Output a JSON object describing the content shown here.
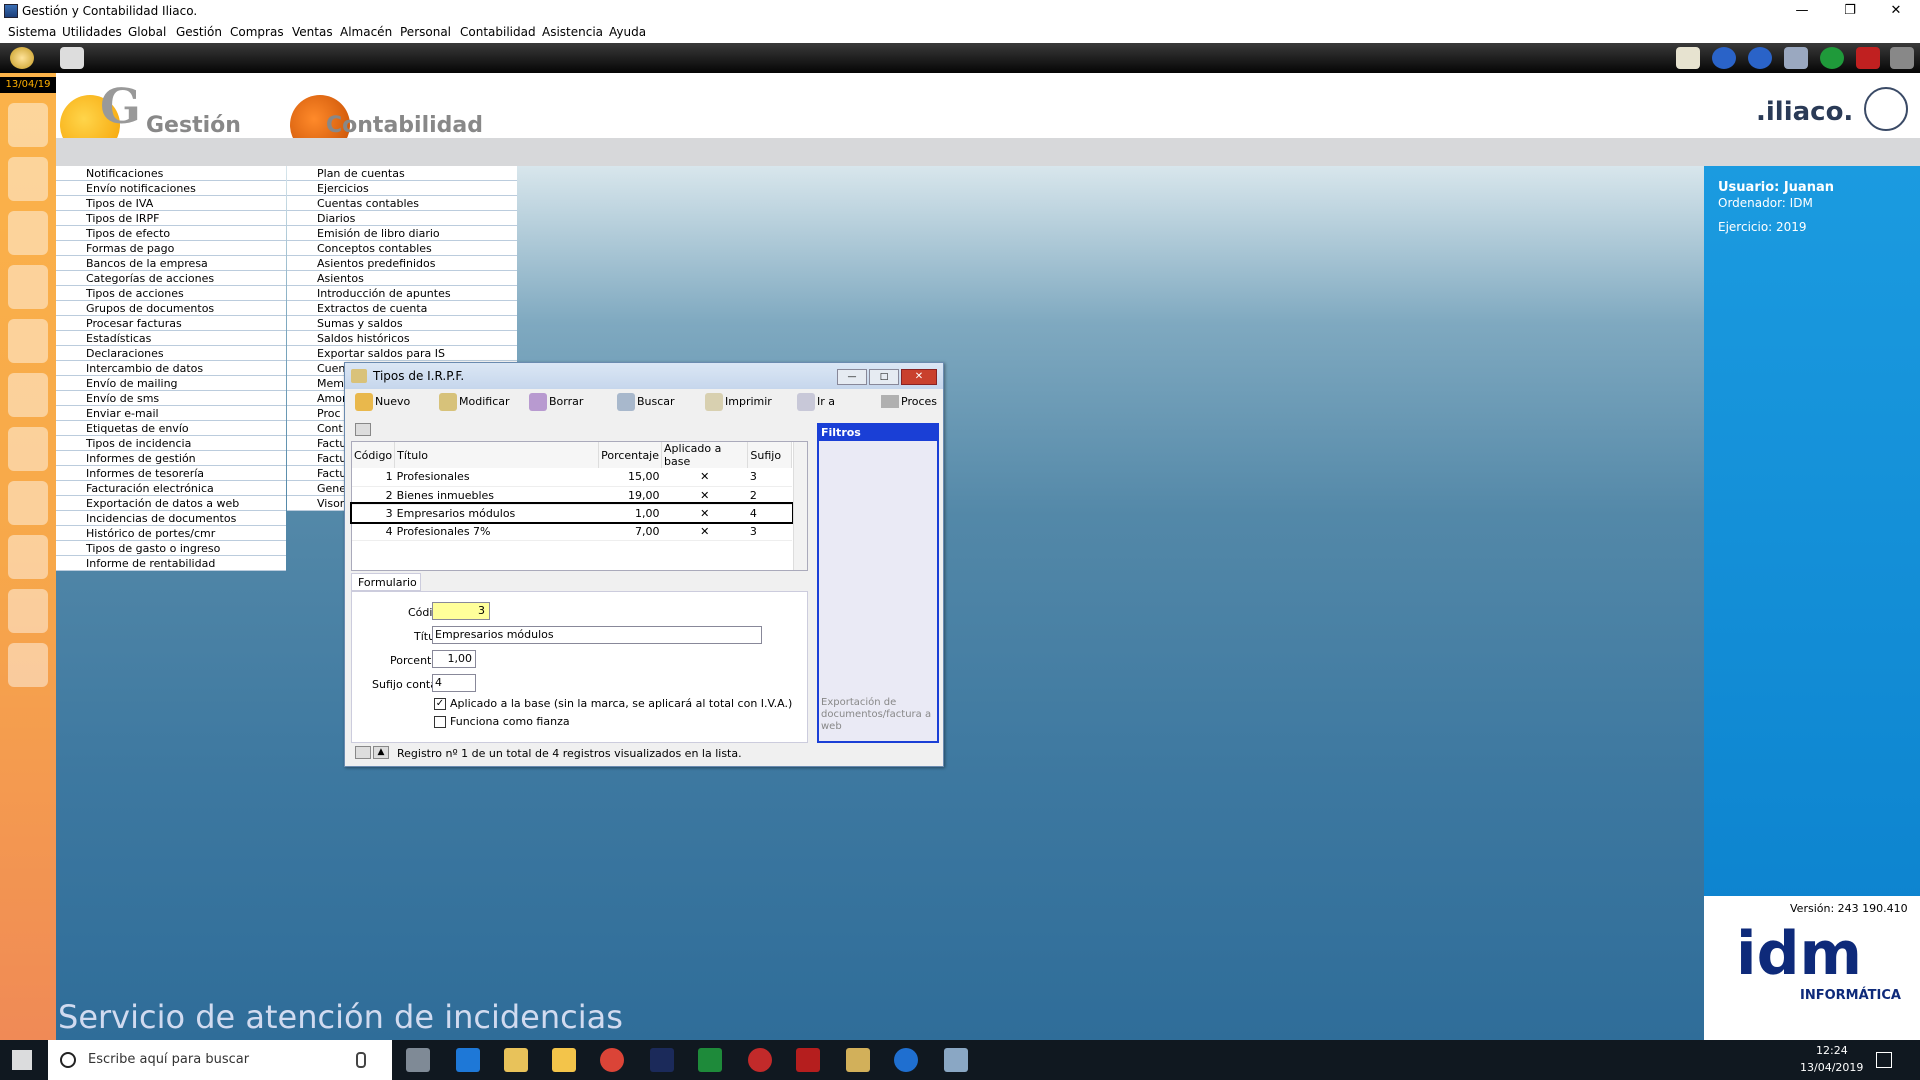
{
  "window": {
    "title": "Gestión y Contabilidad Iliaco.",
    "minimize": "—",
    "restore": "❐",
    "close": "✕"
  },
  "menu": [
    "Sistema",
    "Utilidades",
    "Global",
    "Gestión",
    "Compras",
    "Ventas",
    "Almacén",
    "Personal",
    "Contabilidad",
    "Asistencia",
    "Ayuda"
  ],
  "sidebar": {
    "date": "13/04/19"
  },
  "header": {
    "gestion_logo": "Gestión",
    "contabilidad_logo": "Contabilidad",
    "brand": ".iliaco."
  },
  "menu_col1": [
    "Notificaciones",
    "Envío notificaciones",
    "Tipos de IVA",
    "Tipos de IRPF",
    "Tipos de efecto",
    "Formas de pago",
    "Bancos de la empresa",
    "Categorías de acciones",
    "Tipos de acciones",
    "Grupos de documentos",
    "Procesar facturas",
    "Estadísticas",
    "Declaraciones",
    "Intercambio de datos",
    "Envío de mailing",
    "Envío de sms",
    "Enviar e-mail",
    "Etiquetas de envío",
    "Tipos de incidencia",
    "Informes de gestión",
    "Informes de tesorería",
    "Facturación electrónica",
    "Exportación de datos a web",
    "Incidencias de documentos",
    "Histórico de portes/cmr",
    "Tipos de gasto o ingreso",
    "Informe de rentabilidad"
  ],
  "menu_col2": [
    "Plan de cuentas",
    "Ejercicios",
    "Cuentas contables",
    "Diarios",
    "Emisión de libro diario",
    "Conceptos contables",
    "Asientos predefinidos",
    "Asientos",
    "Introducción de apuntes",
    "Extractos de cuenta",
    "Sumas y saldos",
    "Saldos históricos",
    "Exportar saldos para IS",
    "Cuen",
    "Mem",
    "Amor",
    "Proc",
    "Cont",
    "Factu",
    "Factu",
    "Factu",
    "Gene",
    "Visor"
  ],
  "right_panel": {
    "usuario": "Usuario: Juanan",
    "ordenador": "Ordenador: IDM",
    "ejercicio": "Ejercicio: 2019",
    "version": "Versión: 243 190.410",
    "idm": "idm",
    "informatica": "INFORMÁTICA"
  },
  "footer_text": "Servicio de atención de incidencias",
  "dialog": {
    "title": "Tipos de I.R.P.F.",
    "toolbar": [
      "Nuevo",
      "Modificar",
      "Borrar",
      "Buscar",
      "Imprimir",
      "Ir a",
      "Procesar"
    ],
    "columns": [
      "Código",
      "Título",
      "Porcentaje",
      "Aplicado a base",
      "Sufijo"
    ],
    "rows": [
      {
        "codigo": "1",
        "titulo": "Profesionales",
        "porcentaje": "15,00",
        "aplicado": "✕",
        "sufijo": "3"
      },
      {
        "codigo": "2",
        "titulo": "Bienes inmuebles",
        "porcentaje": "19,00",
        "aplicado": "✕",
        "sufijo": "2"
      },
      {
        "codigo": "3",
        "titulo": "Empresarios módulos",
        "porcentaje": "1,00",
        "aplicado": "✕",
        "sufijo": "4"
      },
      {
        "codigo": "4",
        "titulo": "Profesionales 7%",
        "porcentaje": "7,00",
        "aplicado": "✕",
        "sufijo": "3"
      }
    ],
    "filtros_title": "Filtros",
    "filtros_note": "Exportación de documentos/factura a web",
    "form_tab": "Formulario",
    "form": {
      "codigo_label": "Código",
      "codigo_value": "3",
      "titulo_label": "Título",
      "titulo_value": "Empresarios módulos",
      "porcentaje_label": "Porcentaje",
      "porcentaje_value": "1,00",
      "sufijo_label": "Sufijo contable",
      "sufijo_value": "4",
      "check1_label": "Aplicado a la base (sin la marca, se aplicará al total con I.V.A.)",
      "check2_label": "Funciona como fianza"
    },
    "status": "Registro nº 1 de un total de 4 registros visualizados en la lista."
  },
  "taskbar": {
    "search_placeholder": "Escribe aquí para buscar",
    "time": "12:24",
    "date": "13/04/2019"
  }
}
